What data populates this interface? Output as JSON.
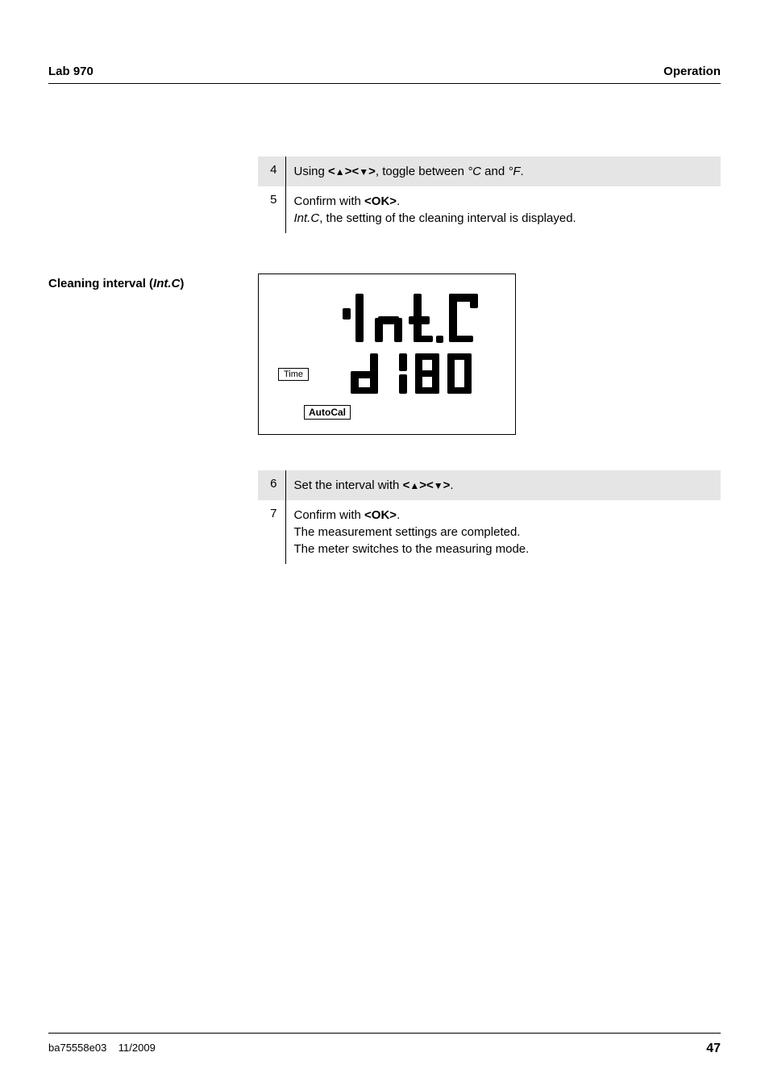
{
  "header": {
    "left": "Lab 970",
    "right": "Operation"
  },
  "steps1": {
    "row4": {
      "num": "4",
      "prefix": "Using ",
      "key_open": "<",
      "key_close": ">",
      "mid": ", toggle between ",
      "unit1": "°C",
      "and": " and ",
      "unit2": "°F",
      "period": "."
    },
    "row5": {
      "num": "5",
      "line1a": "Confirm with ",
      "line1b": "<OK>",
      "line1c": ".",
      "line2a": "Int.C",
      "line2b": ", the setting of the cleaning interval is displayed."
    }
  },
  "section_label": "Cleaning interval (",
  "section_label_italic": "Int.C",
  "section_label_close": ")",
  "display": {
    "main_text": "Int.C",
    "sub_text": "d180",
    "time": "Time",
    "autocal": "AutoCal"
  },
  "steps2": {
    "row6": {
      "num": "6",
      "prefix": "Set the interval with ",
      "period": "."
    },
    "row7": {
      "num": "7",
      "line1a": "Confirm with ",
      "line1b": "<OK>",
      "line1c": ".",
      "line2": "The measurement settings are completed.",
      "line3": "The meter switches to the measuring mode."
    }
  },
  "footer": {
    "left1": "ba75558e03",
    "left2": "11/2009",
    "right": "47"
  }
}
